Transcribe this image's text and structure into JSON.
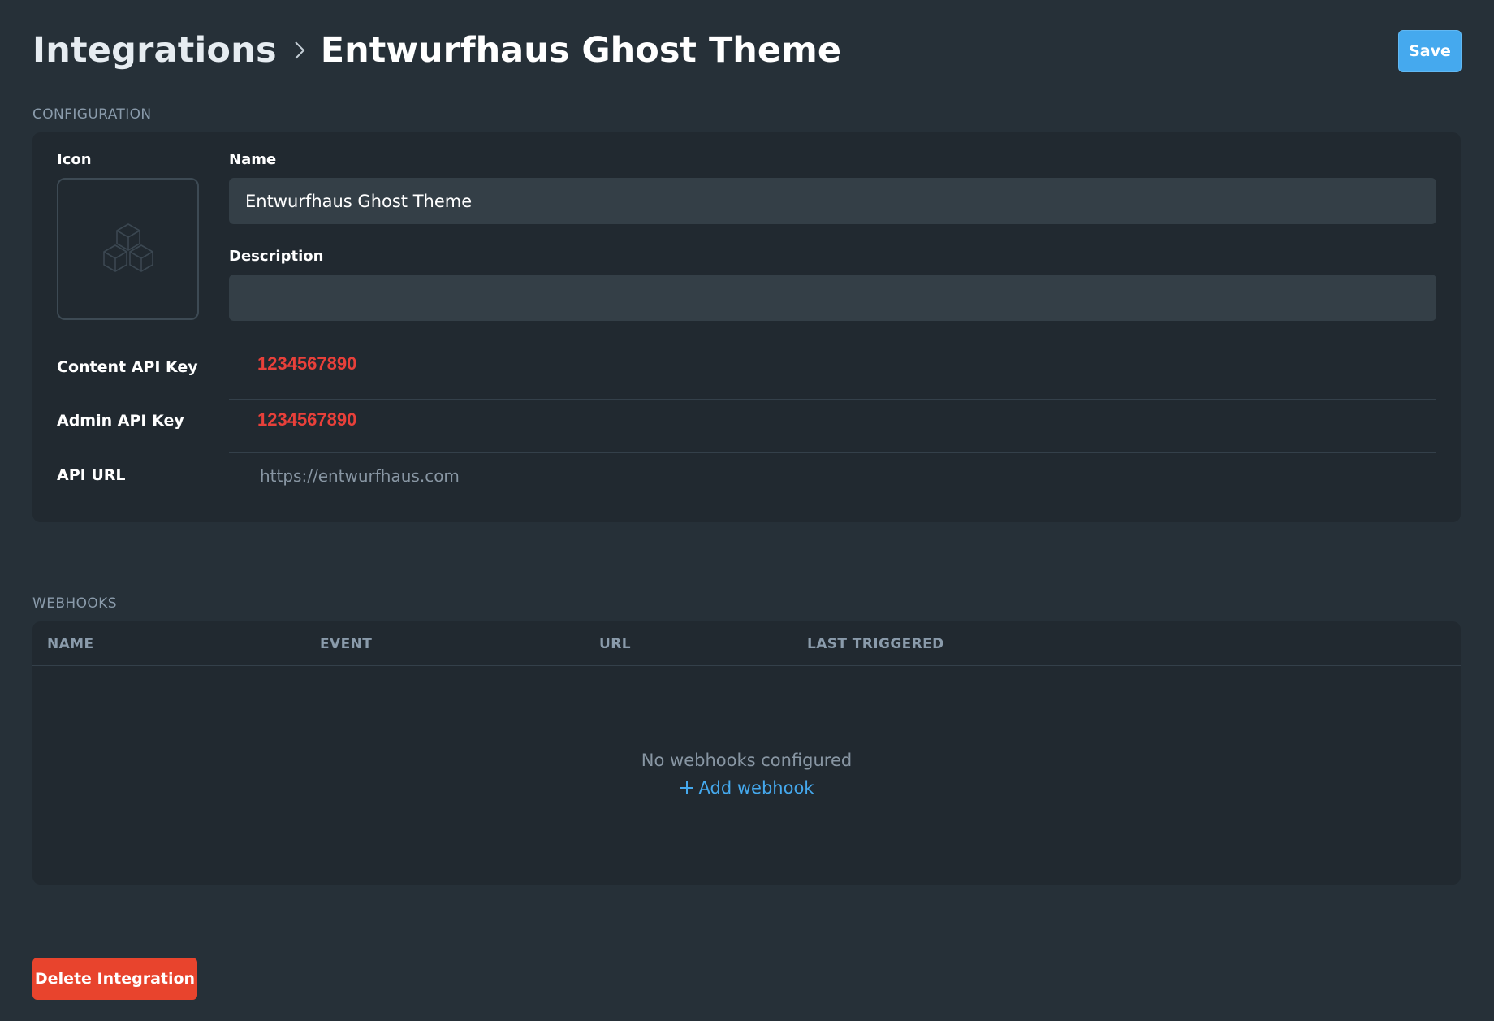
{
  "header": {
    "breadcrumb_root": "Integrations",
    "breadcrumb_current": "Entwurfhaus Ghost Theme",
    "save_label": "Save"
  },
  "configuration": {
    "section_label": "CONFIGURATION",
    "icon_label": "Icon",
    "icon_placeholder": "cubes-icon",
    "name_label": "Name",
    "name_value": "Entwurfhaus Ghost Theme",
    "description_label": "Description",
    "description_value": "",
    "content_api_key_label": "Content API Key",
    "content_api_key_value": "1234567890",
    "admin_api_key_label": "Admin API Key",
    "admin_api_key_value": "1234567890",
    "api_url_label": "API URL",
    "api_url_value": "https://entwurfhaus.com"
  },
  "webhooks": {
    "section_label": "WEBHOOKS",
    "columns": [
      "NAME",
      "EVENT",
      "URL",
      "LAST TRIGGERED"
    ],
    "empty_text": "No webhooks configured",
    "add_label": "Add webhook"
  },
  "footer": {
    "delete_label": "Delete Integration"
  },
  "colors": {
    "background": "#263038",
    "card": "#212930",
    "accent_blue": "#45a9ee",
    "danger": "#e8442d",
    "key_red": "#e8403a"
  }
}
